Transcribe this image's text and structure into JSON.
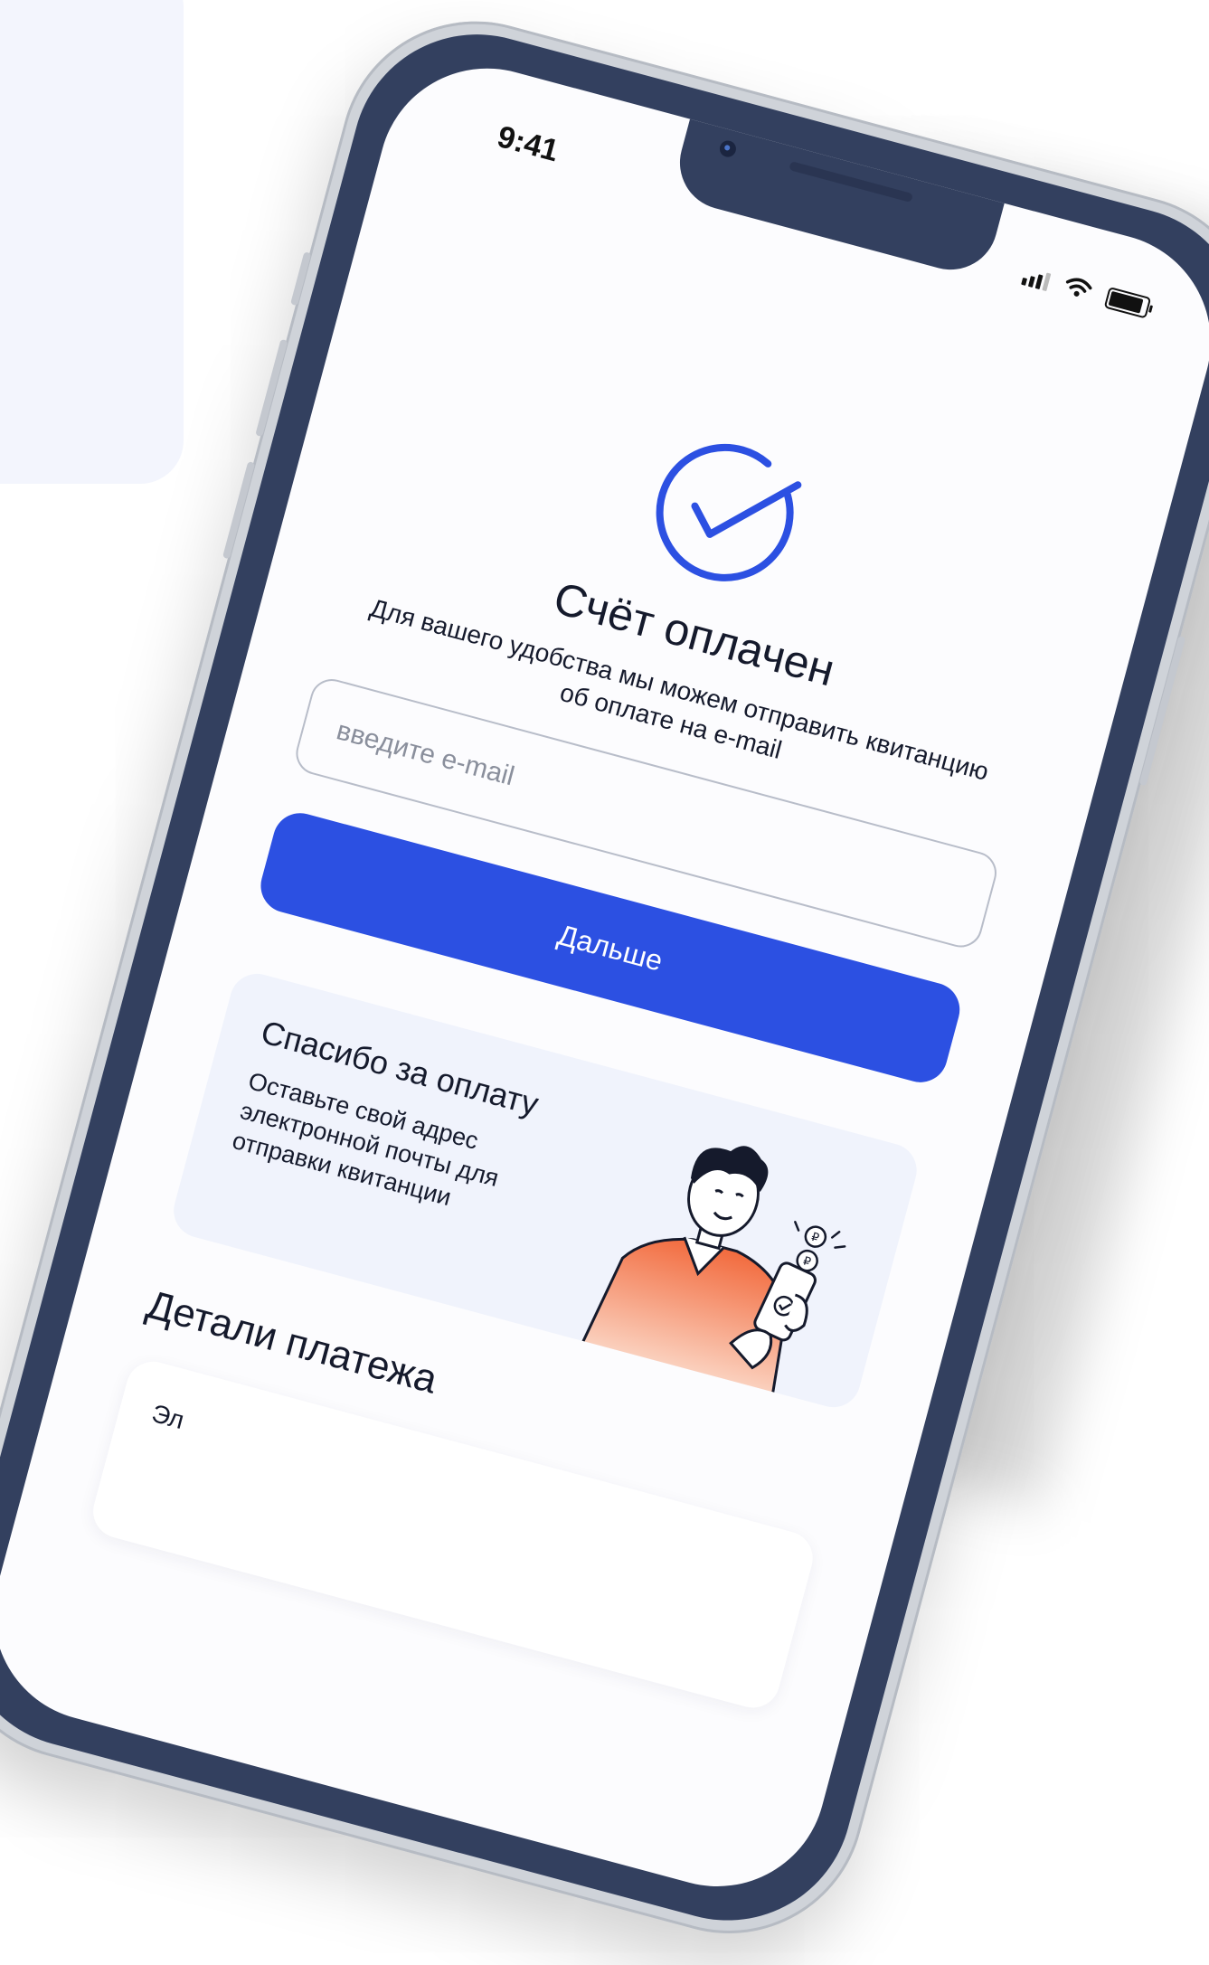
{
  "status_bar": {
    "time": "9:41"
  },
  "success": {
    "title": "Счёт оплачен",
    "subtitle": "Для вашего удобства мы можем отправить квитанцию об оплате на e-mail"
  },
  "email": {
    "placeholder": "введите e-mail",
    "value": ""
  },
  "next_button": {
    "label": "Дальше"
  },
  "thanks_card": {
    "title": "Спасибо за оплату",
    "text": "Оставьте свой адрес электронной почты для отправки квитанции"
  },
  "details": {
    "title": "Детали платежа",
    "first_row_label": "Эл"
  },
  "colors": {
    "accent": "#2c50e2",
    "bezel": "#33405f",
    "card_bg": "#f0f3fc",
    "illustration_orange": "#f26a3d"
  },
  "icons": [
    "check-circle-icon",
    "signal-icon",
    "wifi-icon",
    "battery-icon",
    "ruble-coin-icon"
  ]
}
